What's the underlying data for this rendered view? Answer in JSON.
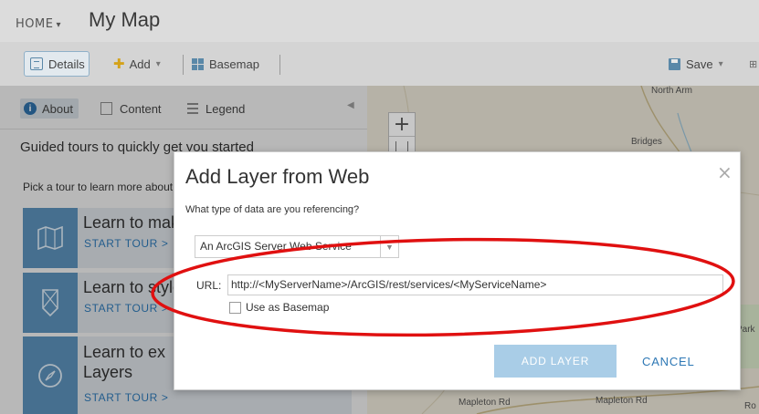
{
  "header": {
    "home_label": "HOME",
    "title": "My Map"
  },
  "toolbar": {
    "details_label": "Details",
    "add_label": "Add",
    "basemap_label": "Basemap",
    "save_label": "Save"
  },
  "panel": {
    "tabs": [
      {
        "label": "About"
      },
      {
        "label": "Content"
      },
      {
        "label": "Legend"
      }
    ],
    "tours_heading": "Guided tours to quickly get you started",
    "tours_subheading": "Pick a tour to learn more about",
    "tours": [
      {
        "title": "Learn to make a map",
        "start_label": "START TOUR >",
        "icon": "map-icon"
      },
      {
        "title": "Learn to style",
        "start_label": "START TOUR >",
        "icon": "style-icon"
      },
      {
        "title": "Learn to explore Layers",
        "title_line1": "Learn to ex",
        "title_line2": "Layers",
        "start_label": "START TOUR >",
        "icon": "compass-icon"
      }
    ]
  },
  "map": {
    "labels": [
      "North Arm",
      "Bridges",
      "Mapleton Rd",
      "Mapleton Rd",
      "Park",
      "Ro"
    ]
  },
  "dialog": {
    "title": "Add Layer from Web",
    "question": "What type of data are you referencing?",
    "data_type_selected": "An ArcGIS Server Web Service",
    "url_label": "URL:",
    "url_value": "http://<MyServerName>/ArcGIS/rest/services/<MyServiceName>",
    "use_as_basemap_label": "Use as Basemap",
    "add_layer_label": "ADD LAYER",
    "cancel_label": "CANCEL"
  },
  "colors": {
    "accent": "#2e78b5",
    "tile": "#5a8fb8",
    "annotation": "#e01010",
    "add_layer_disabled": "#a9cde7"
  }
}
